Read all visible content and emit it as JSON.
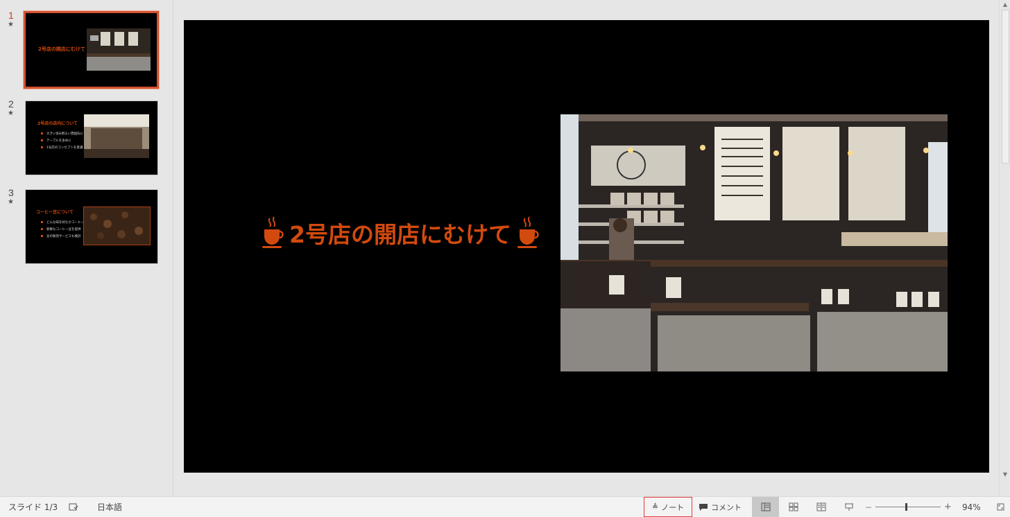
{
  "thumbnails": [
    {
      "number": "1",
      "title": "2号店の開店にむけて",
      "bullets": []
    },
    {
      "number": "2",
      "title": "2号店の店内について",
      "bullets": [
        "大きい窓&明るい雰囲気に",
        "テーブルを多めに",
        "1号店のコンセプトを意識"
      ]
    },
    {
      "number": "3",
      "title": "コーヒー豆について",
      "bullets": [
        "どんな味を好むかコーヒー",
        "新鮮なコーヒー豆を提供",
        "豆の販売サービスも検討"
      ]
    }
  ],
  "slide": {
    "title": "2号店の開店にむけて"
  },
  "statusbar": {
    "slide_counter": "スライド 1/3",
    "language": "日本語",
    "notes_label": "ノート",
    "comments_label": "コメント",
    "zoom_minus": "−",
    "zoom_plus": "+",
    "zoom_level": "94%"
  },
  "colors": {
    "accent": "#d24a0e",
    "thumb_selection": "#d35230",
    "slide_bg": "#000000"
  },
  "icons": [
    "star-icon",
    "coffee-cup-icon",
    "accessibility-check-icon",
    "notes-icon",
    "comment-icon",
    "normal-view-icon",
    "slide-sorter-icon",
    "reading-view-icon",
    "slideshow-icon",
    "fit-to-window-icon",
    "scroll-up-icon",
    "scroll-down-icon"
  ]
}
